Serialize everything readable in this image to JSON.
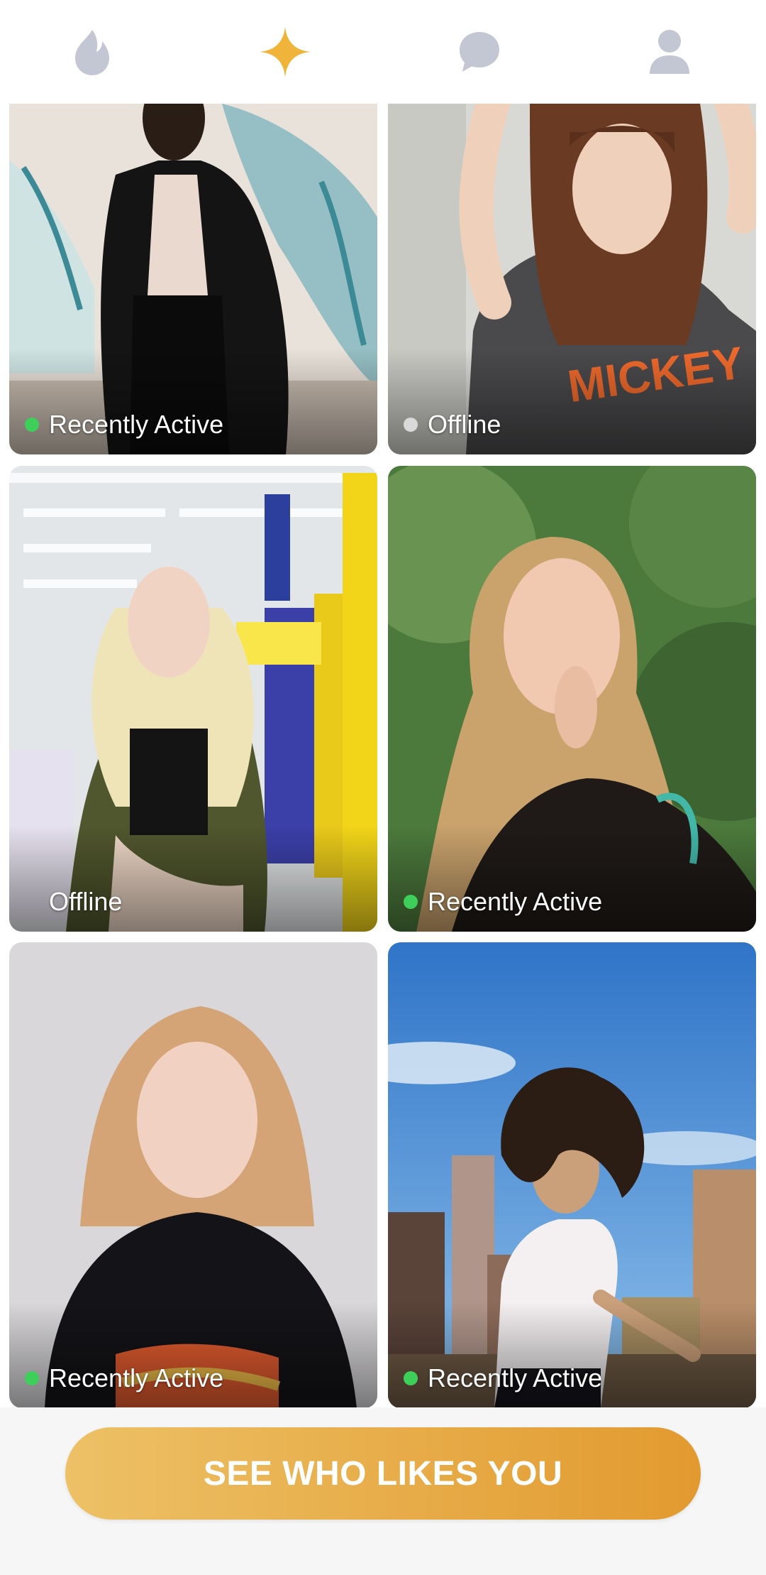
{
  "nav": {
    "tabs": [
      {
        "name": "flame-icon",
        "label": "",
        "active": false
      },
      {
        "name": "sparkle-icon",
        "label": "",
        "active": true
      },
      {
        "name": "chat-bubble-icon",
        "label": "",
        "active": false
      },
      {
        "name": "profile-icon",
        "label": "",
        "active": false
      }
    ],
    "inactive_color": "#c3c7d3",
    "active_color": "#f0b43a"
  },
  "profiles": [
    {
      "status": "Recently Active",
      "online": true,
      "dot_color": "#3ecf5a"
    },
    {
      "status": "Offline",
      "online": false,
      "dot_color": "#d9d9d9"
    },
    {
      "status": "Offline",
      "online": false,
      "dot_color": ""
    },
    {
      "status": "Recently Active",
      "online": true,
      "dot_color": "#3ecf5a"
    },
    {
      "status": "Recently Active",
      "online": true,
      "dot_color": "#3ecf5a"
    },
    {
      "status": "Recently Active",
      "online": true,
      "dot_color": "#3ecf5a"
    }
  ],
  "cta": {
    "label": "SEE WHO LIKES YOU",
    "gradient_start": "#edc166",
    "gradient_end": "#e29a2f"
  }
}
